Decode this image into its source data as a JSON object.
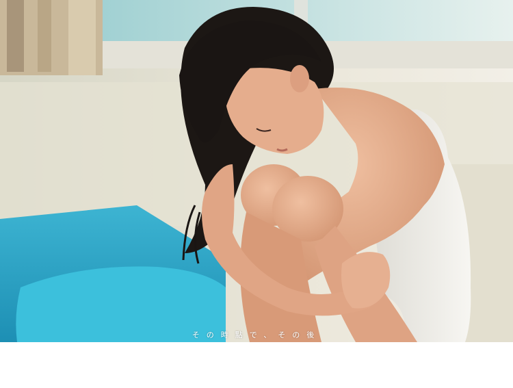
{
  "photo": {
    "caption": "その時點で、その後",
    "colors": {
      "bedding": "#2aa3c6",
      "wall": "#e9e6d8",
      "window": "#b9dcd9",
      "hair": "#1a1614",
      "skin": "#e3a988",
      "top": "#ecebe6",
      "bottom_margin": "#ffffff"
    }
  }
}
